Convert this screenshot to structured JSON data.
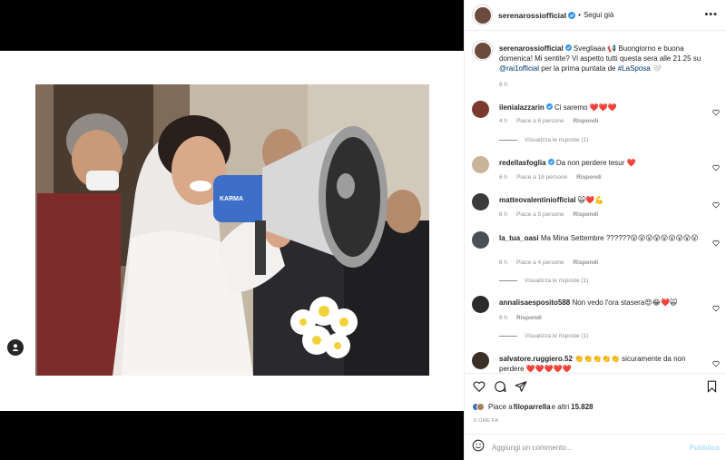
{
  "post": {
    "username": "serenarossiofficial",
    "follow_label": "Segui già",
    "more_label": "•••",
    "caption_parts": {
      "before": " Svegliaaa 📢 Buongiorno e buona domenica! Mi sentite? Vi aspetto tutti questa sera alle 21.25 su ",
      "mention": "@rai1official",
      "middle": " per la prima puntata de ",
      "hashtag": "#LaSposa",
      "after": " 🤍"
    },
    "caption_time": "6 h"
  },
  "comments": [
    {
      "username": "ilenialazzarin",
      "verified": true,
      "text": "Ci saremo ❤️❤️❤️",
      "time": "4 h",
      "likes": "Piace a 8 persone",
      "reply": "Rispondi",
      "replies": "Visualizza le risposte (1)"
    },
    {
      "username": "redellasfoglia",
      "verified": true,
      "text": "Da non perdere tesur ❤️",
      "time": "6 h",
      "likes": "Piace a 18 persone",
      "reply": "Rispondi",
      "replies": ""
    },
    {
      "username": "matteovalentiniofficial",
      "verified": false,
      "text": "🙀❤️💪",
      "time": "6 h",
      "likes": "Piace a 5 persone",
      "reply": "Rispondi",
      "replies": ""
    },
    {
      "username": "la_tua_oasi",
      "verified": false,
      "text": "Ma Mina Settembre ??????😮😮😮😮😮😮😮😮😮",
      "time": "6 h",
      "likes": "Piace a 4 persone",
      "reply": "Rispondi",
      "replies": "Visualizza le risposte (1)"
    },
    {
      "username": "annalisaesposito588",
      "verified": false,
      "text": "Non vedo l'ora stasera😍😂❤️🙀",
      "time": "6 h",
      "likes": "",
      "reply": "Rispondi",
      "replies": "Visualizza le risposte (1)"
    },
    {
      "username": "salvatore.ruggiero.52",
      "verified": false,
      "text": "👏👏👏👏👏 sicuramente da non perdere ❤️❤️❤️❤️❤️",
      "time": "",
      "likes": "",
      "reply": "",
      "replies": ""
    }
  ],
  "likes_line": {
    "prefix": "Piace a ",
    "user": "filoparrella",
    "suffix": " e altri ",
    "count": "15.828"
  },
  "post_time": "6 ORE FA",
  "comment_input": {
    "placeholder": "Aggiungi un commento...",
    "publish_label": "Pubblica"
  },
  "photo": {
    "megaphone_brand": "KARMA"
  },
  "icons": {
    "verified": "verified-badge-icon",
    "heart": "heart-icon",
    "comment": "comment-icon",
    "share": "share-icon",
    "save": "bookmark-icon",
    "emoji": "emoji-icon",
    "tag": "user-tag-icon"
  },
  "colors": {
    "verified": "#3897f0",
    "link": "#00376b",
    "muted": "#8e8e8e",
    "publish": "#b2dffc"
  }
}
